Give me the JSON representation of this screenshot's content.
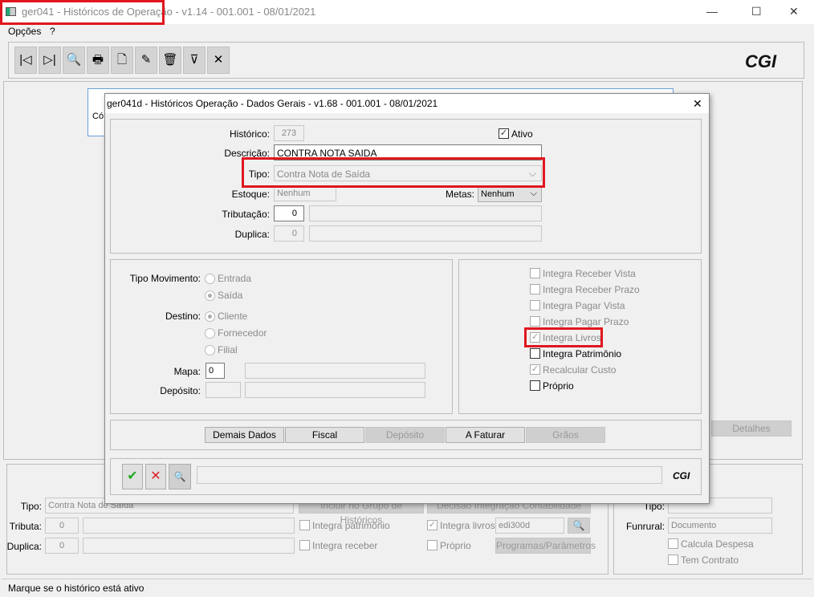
{
  "window": {
    "title": "ger041 - Históricos de Operação - v1.14 - 001.001 - 08/01/2021",
    "minimize": "—",
    "maximize": "☐",
    "close": "✕"
  },
  "menu": [
    "Opções",
    "?"
  ],
  "toolbar": [
    {
      "name": "first",
      "glyph": "|◁"
    },
    {
      "name": "last",
      "glyph": "▷|"
    },
    {
      "name": "search",
      "glyph": "🔍"
    },
    {
      "name": "print",
      "glyph": "🖶"
    },
    {
      "name": "new",
      "glyph": "🗋"
    },
    {
      "name": "edit",
      "glyph": "✎"
    },
    {
      "name": "delete",
      "glyph": "🗑"
    },
    {
      "name": "filter",
      "glyph": "⊽"
    },
    {
      "name": "cancel",
      "glyph": "✕"
    }
  ],
  "logo": "CGI",
  "grid_header": "Có",
  "detalhes": "Detalhes",
  "bottom": {
    "tipo_label": "Tipo:",
    "tipo_value": "Contra Nota de Saída",
    "tributa_label": "Tributa:",
    "tributa_value": "0",
    "duplica_label": "Duplica:",
    "duplica_value": "0",
    "btn_grupo": "Incluir no Grupo de Históricos",
    "btn_decisao": "Decisão Integração Contabilidade",
    "integra_patrimonio": "Integra patrimônio",
    "integra_receber": "Integra receber",
    "integra_livros": "Integra livros",
    "proprio": "Próprio",
    "edi_value": "edi300d",
    "programas": "Programas/Parâmetros"
  },
  "right": {
    "tipo_label": "Tipo:",
    "funrural_label": "Funrural:",
    "funrural_value": "Documento",
    "calcula_despesa": "Calcula Despesa",
    "tem_contrato": "Tem Contrato"
  },
  "status": "Marque se o histórico está ativo",
  "dialog": {
    "title": "ger041d - Históricos Operação - Dados Gerais - v1.68 - 001.001 - 08/01/2021",
    "close": "✕",
    "historico_label": "Histórico:",
    "historico_value": "273",
    "ativo": "Ativo",
    "ativo_checked": true,
    "descricao_label": "Descrição:",
    "descricao_value": "CONTRA NOTA SAIDA",
    "tipo_label": "Tipo:",
    "tipo_value": "Contra Nota de Saída",
    "estoque_label": "Estoque:",
    "estoque_value": "Nenhum",
    "metas_label": "Metas:",
    "metas_value": "Nenhum",
    "tributacao_label": "Tributação:",
    "tributacao_value": "0",
    "duplica_label": "Duplica:",
    "duplica_value": "0",
    "tipo_mov_label": "Tipo Movimento:",
    "tipo_mov_options": [
      "Entrada",
      "Saída"
    ],
    "tipo_mov_selected": "Saída",
    "destino_label": "Destino:",
    "destino_options": [
      "Cliente",
      "Fornecedor",
      "Filial"
    ],
    "destino_selected": "Cliente",
    "mapa_label": "Mapa:",
    "mapa_value": "0",
    "deposito_label": "Depósito:",
    "checks": [
      {
        "label": "Integra Receber Vista",
        "checked": false,
        "enabled": false
      },
      {
        "label": "Integra Receber Prazo",
        "checked": false,
        "enabled": false
      },
      {
        "label": "Integra Pagar Vista",
        "checked": false,
        "enabled": false
      },
      {
        "label": "Integra Pagar Prazo",
        "checked": false,
        "enabled": false
      },
      {
        "label": "Integra Livros",
        "checked": true,
        "enabled": false
      },
      {
        "label": "Integra Patrimônio",
        "checked": false,
        "enabled": true
      },
      {
        "label": "Recalcular Custo",
        "checked": true,
        "enabled": false
      },
      {
        "label": "Próprio",
        "checked": false,
        "enabled": true
      }
    ],
    "tabs": [
      {
        "label": "Demais Dados",
        "enabled": true
      },
      {
        "label": "Fiscal",
        "enabled": true
      },
      {
        "label": "Depósito",
        "enabled": false
      },
      {
        "label": "A Faturar",
        "enabled": true
      },
      {
        "label": "Grãos",
        "enabled": false
      }
    ],
    "ok_glyph": "✔",
    "cancel_glyph": "✕",
    "search_glyph": "🔍",
    "logo": "CGI"
  },
  "highlight_color": "#e0161e"
}
